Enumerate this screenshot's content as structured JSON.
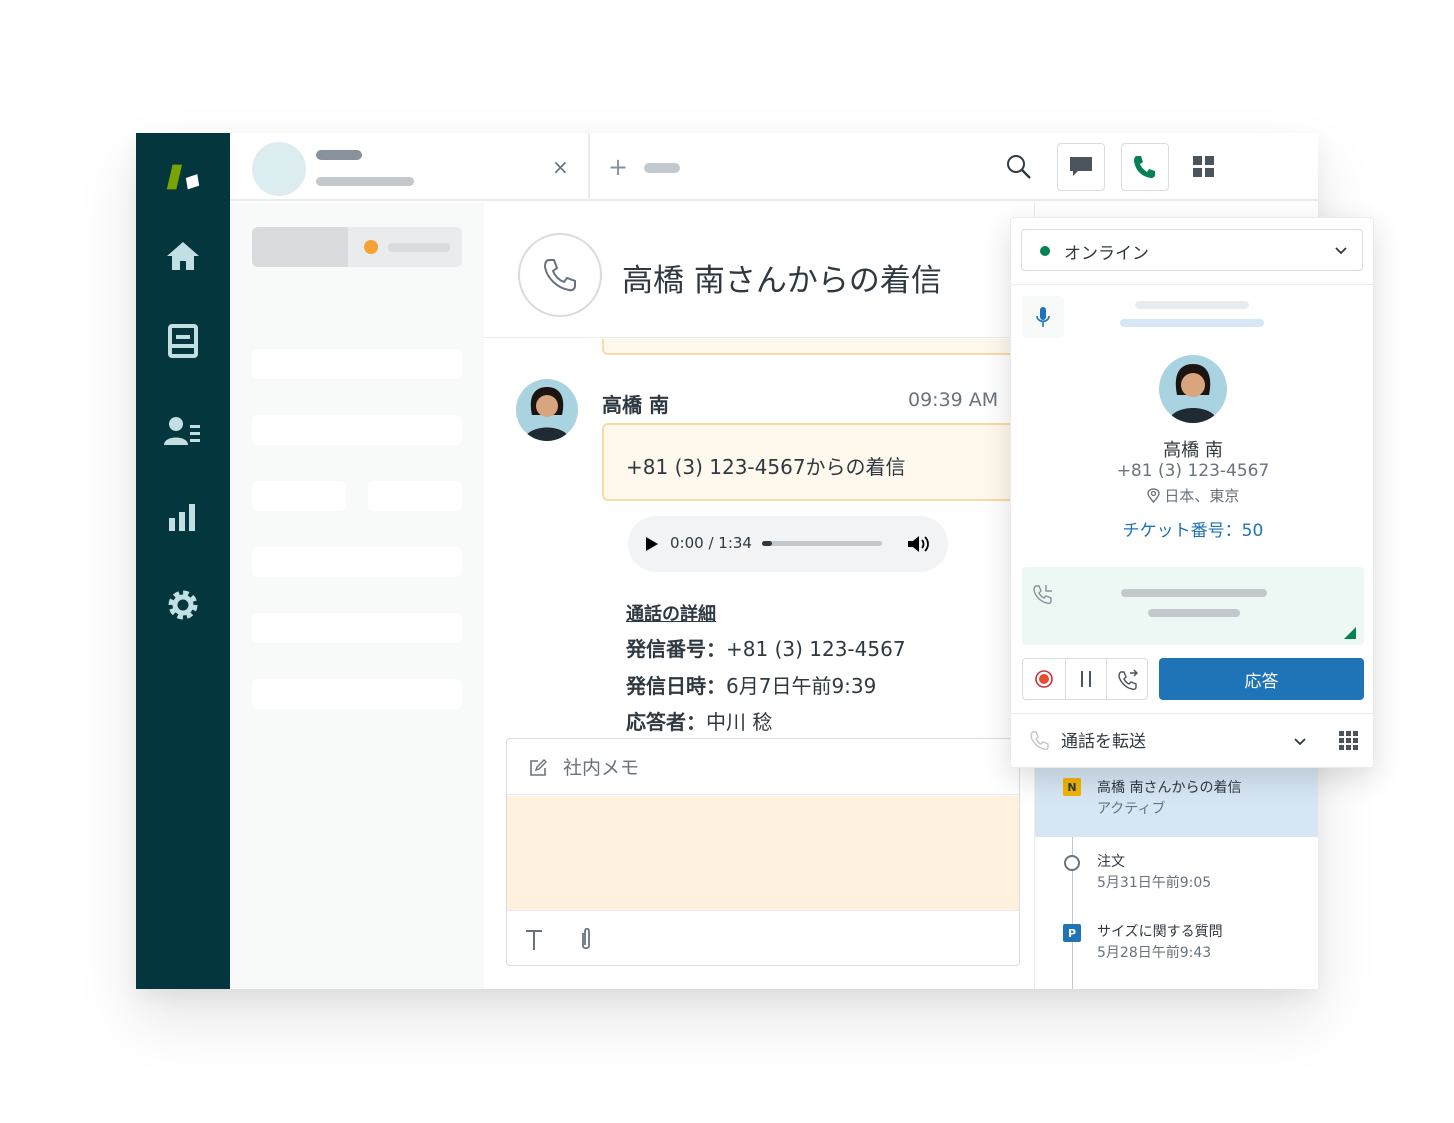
{
  "conversation": {
    "header_title": "高橋 南さんからの着信",
    "sender_name": "高橋 南",
    "time": "09:39 AM",
    "message": "+81 (3) 123-4567からの着信",
    "audio": {
      "time": "0:00 / 1:34",
      "progress": 0.08
    },
    "details": {
      "title": "通話の詳細",
      "caller_label": "発信番号：",
      "caller_value": "+81 (3) 123-4567",
      "date_label": "発信日時：",
      "date_value": "6月7日午前9:39",
      "agent_label": "応答者：",
      "agent_value": "中川 稔"
    },
    "memo_label": "社内メモ"
  },
  "tab": {
    "close_label": "×",
    "add_label": "+"
  },
  "talk": {
    "status": "オンライン",
    "caller_name": "高橋 南",
    "caller_phone": "+81 (3) 123-4567",
    "caller_location": "日本、東京",
    "ticket": "チケット番号：50",
    "answer_label": "応答",
    "transfer_label": "通話を転送"
  },
  "timeline": [
    {
      "badge": "N",
      "title": "高橋 南さんからの着信",
      "sub": "アクティブ"
    },
    {
      "badge": "",
      "title": "注文",
      "sub": "5月31日午前9:05"
    },
    {
      "badge": "P",
      "title": "サイズに関する質問",
      "sub": "5月28日午前9:43"
    }
  ],
  "colors": {
    "sidebar": "#03363d",
    "brand_green": "#78a300",
    "accent_blue": "#1f73b7",
    "online_green": "#038153",
    "badge_new": "#f0b400",
    "badge_pending": "#1f73b7"
  },
  "icons": [
    "zendesk-logo-icon",
    "home-icon",
    "views-icon",
    "customers-icon",
    "reporting-icon",
    "settings-icon",
    "search-icon",
    "chat-icon",
    "phone-icon",
    "apps-grid-icon",
    "mic-icon",
    "location-icon",
    "record-icon",
    "pause-icon",
    "transfer-icon",
    "keypad-icon",
    "note-icon",
    "text-format-icon",
    "attachment-icon"
  ]
}
